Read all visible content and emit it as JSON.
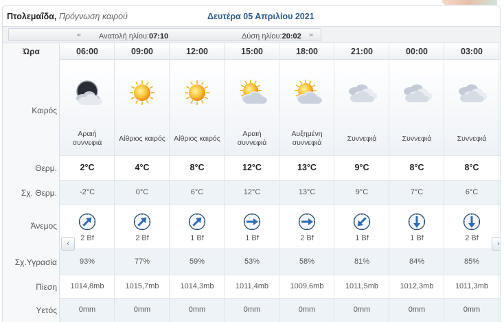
{
  "header": {
    "city": "Πτολεμαΐδα,",
    "subtitle": "Πρόγνωση καιρού",
    "date": "Δευτέρα 05 Απριλίου 2021"
  },
  "sun": {
    "sunrise_label": "Ανατολή ηλίου:",
    "sunrise_time": "07:10",
    "sunset_label": "Δύση ηλίου:",
    "sunset_time": "20:02",
    "left_arrows": "‹‹‹",
    "right_arrows": "›››"
  },
  "labels": {
    "hour": "Ώρα",
    "weather": "Καιρός",
    "temp": "Θερμ.",
    "feels": "Σχ. Θερμ.",
    "wind": "Άνεμος",
    "humidity": "Σχ.Υγρασία",
    "pressure": "Πίεση",
    "rain": "Υετός"
  },
  "nav": {
    "prev": "‹",
    "next": "›"
  },
  "colors": {
    "accent": "#2c5a8c",
    "wind_icon": "#2e6db5",
    "sun": "#f5a623"
  },
  "forecast": [
    {
      "hour": "06:00",
      "icon": "moon-cloud-icon",
      "cond": [
        "Αραιή",
        "συννεφιά"
      ],
      "temp": "2°C",
      "feels": "-2°C",
      "wind_dir": "north-east",
      "wind_bf": "2 Bf",
      "humidity": "93%",
      "pressure": "1014,8mb",
      "rain": "0mm"
    },
    {
      "hour": "09:00",
      "icon": "sun-icon",
      "cond": [
        "Αίθριος καιρός"
      ],
      "temp": "4°C",
      "feels": "0°C",
      "wind_dir": "north-east",
      "wind_bf": "2 Bf",
      "humidity": "77%",
      "pressure": "1015,7mb",
      "rain": "0mm"
    },
    {
      "hour": "12:00",
      "icon": "sun-icon",
      "cond": [
        "Αίθριος καιρός"
      ],
      "temp": "8°C",
      "feels": "6°C",
      "wind_dir": "north-east",
      "wind_bf": "1 Bf",
      "humidity": "59%",
      "pressure": "1014,3mb",
      "rain": "0mm"
    },
    {
      "hour": "15:00",
      "icon": "sun-cloud-icon",
      "cond": [
        "Αραιή",
        "συννεφιά"
      ],
      "temp": "12°C",
      "feels": "12°C",
      "wind_dir": "east",
      "wind_bf": "1 Bf",
      "humidity": "53%",
      "pressure": "1011,4mb",
      "rain": "0mm"
    },
    {
      "hour": "18:00",
      "icon": "sun-cloud-icon",
      "cond": [
        "Αυξημένη",
        "συννεφιά"
      ],
      "temp": "13°C",
      "feels": "13°C",
      "wind_dir": "east",
      "wind_bf": "2 Bf",
      "humidity": "58%",
      "pressure": "1009,6mb",
      "rain": "0mm"
    },
    {
      "hour": "21:00",
      "icon": "clouds-icon",
      "cond": [
        "Συννεφιά"
      ],
      "temp": "9°C",
      "feels": "9°C",
      "wind_dir": "south-west",
      "wind_bf": "1 Bf",
      "humidity": "81%",
      "pressure": "1011,5mb",
      "rain": "0mm"
    },
    {
      "hour": "00:00",
      "icon": "clouds-icon",
      "cond": [
        "Συννεφιά"
      ],
      "temp": "8°C",
      "feels": "7°C",
      "wind_dir": "south",
      "wind_bf": "1 Bf",
      "humidity": "84%",
      "pressure": "1012,3mb",
      "rain": "0mm"
    },
    {
      "hour": "03:00",
      "icon": "clouds-icon",
      "cond": [
        "Συννεφιά"
      ],
      "temp": "8°C",
      "feels": "6°C",
      "wind_dir": "south",
      "wind_bf": "2 Bf",
      "humidity": "85%",
      "pressure": "1011,3mb",
      "rain": "0mm"
    }
  ]
}
